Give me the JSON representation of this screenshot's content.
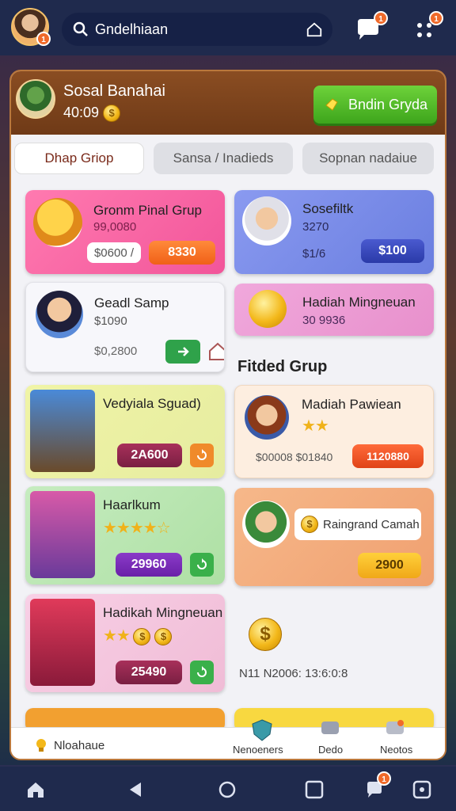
{
  "topbar": {
    "search_text": "Gndelhiaan",
    "avatar_badge": "1",
    "notif_badge": "1",
    "menu_badge": "1"
  },
  "header": {
    "name": "Sosal Banahai",
    "amount": "40:09",
    "button_label": "Bndin Gryda"
  },
  "tabs": [
    "Dhap Griop",
    "Sansa / Inadieds",
    "Sopnan nadaiue"
  ],
  "left_cards": [
    {
      "title": "Gronm Pinal Grup",
      "sub": "99,0080",
      "value": "$0600 /",
      "button": "8330"
    },
    {
      "title": "Geadl Samp",
      "sub": "$1090",
      "value": "$0,2800"
    },
    {
      "title": "Vedyiala Sguad)",
      "button": "2A600"
    },
    {
      "title": "Haarlkum",
      "button": "29960"
    },
    {
      "title": "Hadikah Mingneuan",
      "button": "25490"
    }
  ],
  "right_cards": [
    {
      "title": "Sosefiltk",
      "sub": "3270",
      "sub2": "$1/6",
      "button": "$100"
    },
    {
      "title": "Hadiah Mingneuan",
      "sub": "30 9936"
    },
    {
      "title": "Madiah Pawiean",
      "sub": "$00008 $01840",
      "button": "1120880"
    },
    {
      "title": "Raingrand Camah",
      "button": "2900"
    }
  ],
  "section_title": "Fitded Grup",
  "timestamp": "N11 N2006: 13:6:0:8",
  "bottom_labels": [
    "Nloahaue",
    "Nenoeners",
    "Dedo",
    "Neotos"
  ],
  "nav_badge": "1",
  "colors": {
    "accent_green": "#3ea51c",
    "brand_brown": "#7a4320",
    "nav": "#1f2a4d"
  }
}
